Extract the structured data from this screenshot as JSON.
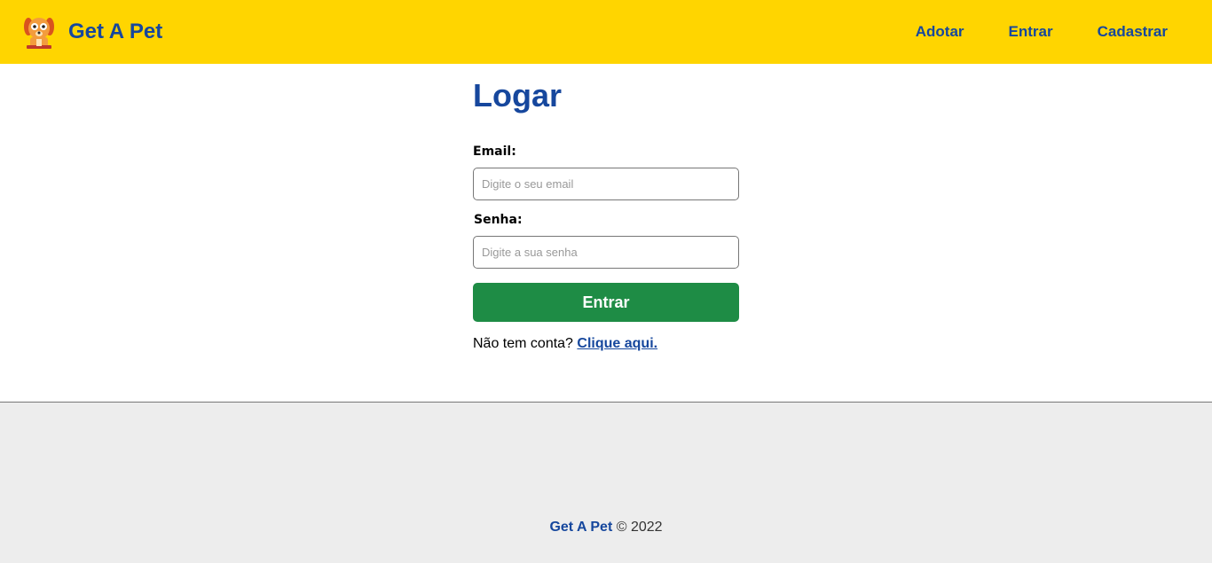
{
  "navbar": {
    "brand_name": "Get A Pet",
    "logo_icon": "dog-face-icon",
    "links": [
      {
        "label": "Adotar"
      },
      {
        "label": "Entrar"
      },
      {
        "label": "Cadastrar"
      }
    ]
  },
  "login": {
    "title": "Logar",
    "email": {
      "label": "Email:",
      "placeholder": "Digite o seu email",
      "value": ""
    },
    "password": {
      "label": "Senha:",
      "placeholder": "Digite a sua senha",
      "value": ""
    },
    "submit_label": "Entrar",
    "signup_prompt": "Não tem conta?",
    "signup_link": "Clique aqui."
  },
  "footer": {
    "brand": "Get A Pet",
    "copyright": "© 2022"
  },
  "colors": {
    "navbar_bg": "#FFD500",
    "brand_blue": "#16479d",
    "button_green": "#1e8c45",
    "footer_bg": "#ededed"
  }
}
